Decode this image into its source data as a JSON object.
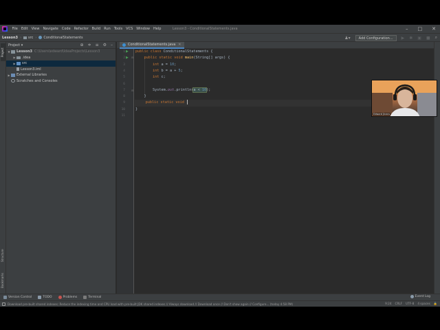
{
  "menubar": {
    "items": [
      "File",
      "Edit",
      "View",
      "Navigate",
      "Code",
      "Refactor",
      "Build",
      "Run",
      "Tools",
      "VCS",
      "Window",
      "Help"
    ],
    "window_title": "Lesson3 - ConditionalStatements.java"
  },
  "navbar": {
    "crumb_project": "Lesson3",
    "crumb_src": "src",
    "crumb_class": "ConditionalStatements",
    "add_configuration": "Add Configuration..."
  },
  "left_strip": {
    "project_tab": "Project",
    "structure_tab": "Structure",
    "bookmarks_tab": "Bookmarks"
  },
  "project_panel": {
    "title": "Project",
    "tree": [
      {
        "label": "Lesson3",
        "path": "C:\\Users\\edward\\IdeaProjects\\Lesson3",
        "arrow": "▼"
      },
      {
        "label": ".idea",
        "arrow": "▶"
      },
      {
        "label": "src",
        "arrow": "▶"
      },
      {
        "label": "Lesson3.iml",
        "arrow": ""
      },
      {
        "label": "External Libraries",
        "arrow": "▶"
      },
      {
        "label": "Scratches and Consoles",
        "arrow": ""
      }
    ]
  },
  "editor": {
    "tab_label": "ConditionalStatements.java",
    "line_numbers": [
      "1",
      "2",
      "3",
      "4",
      "5",
      "6",
      "7",
      "8",
      "9",
      "10",
      "11"
    ]
  },
  "webcam": {
    "name": "Edward Jinaru"
  },
  "tool_bar": {
    "version_control": "Version Control",
    "todo": "TODO",
    "problems": "Problems",
    "terminal": "Terminal",
    "event_log": "Event Log"
  },
  "status_bar": {
    "message": "Download pre-built shared indexes: Reduce the indexing time and CPU load with pre-built JDK shared indexes // Always download // Download once // Don't show again // Configure... (today 4:58 PM)",
    "position": "9:24",
    "line_sep": "CRLF",
    "encoding": "UTF-8",
    "indent": "4 spaces"
  },
  "colors": {
    "keyword": "#cc7832",
    "method": "#ffc66d",
    "number": "#6897bb",
    "field": "#9876aa",
    "text": "#a9b7c6",
    "editor_bg": "#2b2b2b",
    "panel_bg": "#3c3f41",
    "selection": "#0d293e"
  }
}
